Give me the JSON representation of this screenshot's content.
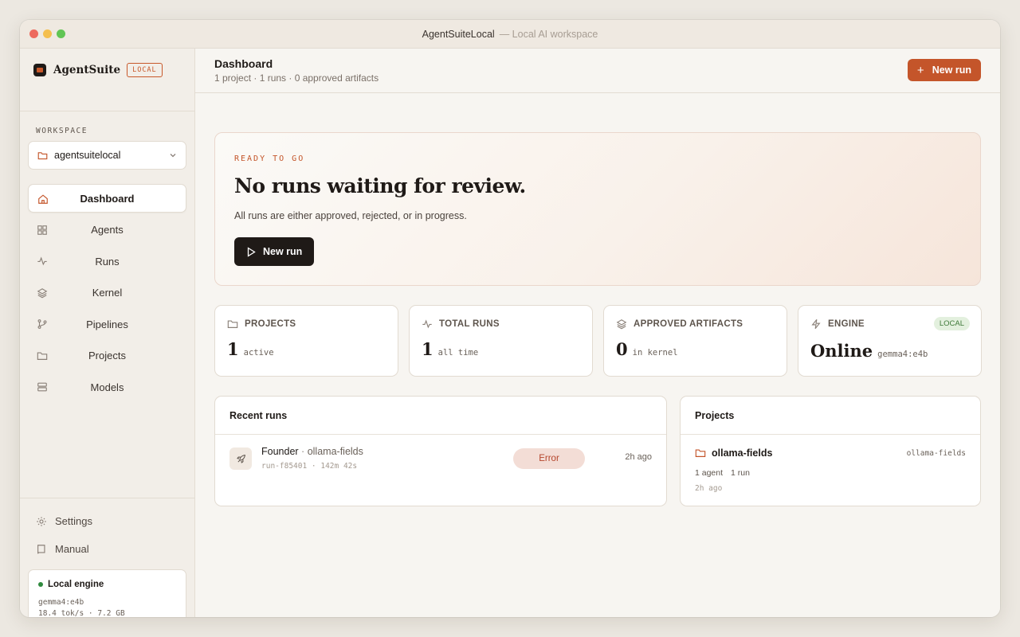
{
  "window": {
    "title": "AgentSuiteLocal",
    "subtitle": "— Local AI workspace"
  },
  "sidebar": {
    "brand_name": "AgentSuite",
    "brand_badge": "LOCAL",
    "workspace_label": "WORKSPACE",
    "workspace_value": "agentsuitelocal",
    "items": [
      {
        "label": "Dashboard",
        "icon": "home-icon",
        "active": true
      },
      {
        "label": "Agents",
        "icon": "grid-icon"
      },
      {
        "label": "Runs",
        "icon": "activity-icon"
      },
      {
        "label": "Kernel",
        "icon": "layers-icon"
      },
      {
        "label": "Pipelines",
        "icon": "git-branch-icon"
      },
      {
        "label": "Projects",
        "icon": "folder-icon"
      },
      {
        "label": "Models",
        "icon": "server-icon"
      }
    ],
    "footer": {
      "settings_label": "Settings",
      "manual_label": "Manual"
    },
    "engine": {
      "title": "Local engine",
      "model": "gemma4:e4b",
      "stats": "18.4 tok/s · 7.2 GB",
      "status_color": "#2f8a3e"
    }
  },
  "header": {
    "title": "Dashboard",
    "subtitle": "1 project · 1 runs · 0 approved artifacts",
    "new_run_label": "New run",
    "accent": "#c4552a"
  },
  "hero": {
    "eyebrow": "READY TO GO",
    "title": "No runs waiting for review.",
    "subtitle": "All runs are either approved, rejected, or in progress.",
    "button_label": "New run"
  },
  "stats": [
    {
      "label": "PROJECTS",
      "value": "1",
      "unit": "active",
      "icon": "folder-icon"
    },
    {
      "label": "TOTAL RUNS",
      "value": "1",
      "unit": "all time",
      "icon": "activity-icon"
    },
    {
      "label": "APPROVED ARTIFACTS",
      "value": "0",
      "unit": "in kernel",
      "icon": "layers-icon"
    },
    {
      "label": "ENGINE",
      "value": "Online",
      "unit": "gemma4:e4b",
      "badge": "LOCAL",
      "icon": "zap-icon"
    }
  ],
  "recent_runs": {
    "title": "Recent runs",
    "rows": [
      {
        "agent": "Founder",
        "separator": "·",
        "project": "ollama-fields",
        "meta": "run-f85401 · 142m 42s",
        "status": "Error",
        "time": "2h ago",
        "icon": "rocket-icon"
      }
    ]
  },
  "projects": {
    "title": "Projects",
    "rows": [
      {
        "name": "ollama-fields",
        "slug": "ollama-fields",
        "agents": "1 agent",
        "runs": "1 run",
        "time": "2h ago",
        "icon": "folder-icon"
      }
    ]
  }
}
